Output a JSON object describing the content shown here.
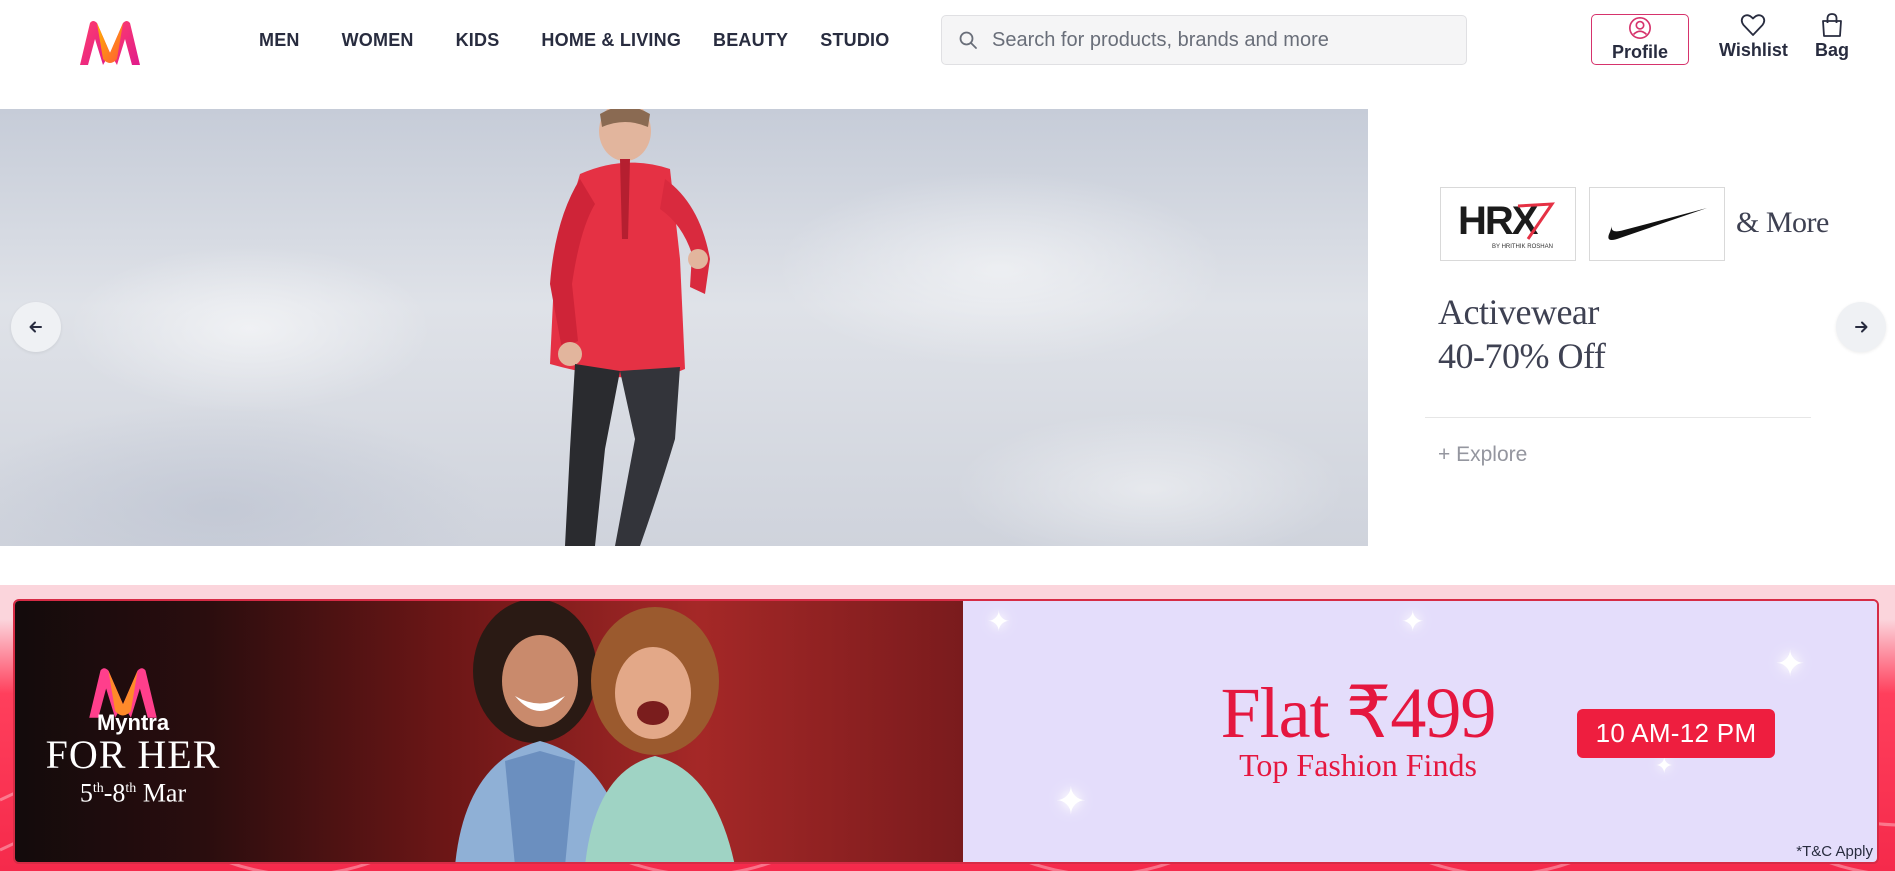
{
  "header": {
    "nav": [
      "MEN",
      "WOMEN",
      "KIDS",
      "HOME & LIVING",
      "BEAUTY",
      "STUDIO"
    ],
    "search_placeholder": "Search for products, brands and more",
    "actions": {
      "profile": "Profile",
      "wishlist": "Wishlist",
      "bag": "Bag"
    },
    "icons": [
      "myntra-logo",
      "search-icon",
      "user-icon",
      "heart-icon",
      "bag-icon"
    ]
  },
  "hero": {
    "brands": [
      "HRX",
      "BY HRITHIK ROSHAN",
      "Nike"
    ],
    "more": "& More",
    "title_line1": "Activewear",
    "title_line2": "40-70% Off",
    "cta": "+ Explore",
    "icons": [
      "arrow-left-icon",
      "arrow-right-icon"
    ]
  },
  "banner": {
    "brand": "Myntra",
    "event": "FOR HER",
    "date_start": "5",
    "date_start_sup": "th",
    "date_end": "-8",
    "date_end_sup": "th",
    "date_month": " Mar",
    "offer": "Flat ₹499",
    "tagline": "Top Fashion Finds",
    "time": "10 AM-12 PM",
    "terms": "*T&C Apply"
  },
  "colors": {
    "brand_pink": "#ff3f6c",
    "offer_red": "#e5173f",
    "banner_lavender": "#e4ddfb"
  }
}
